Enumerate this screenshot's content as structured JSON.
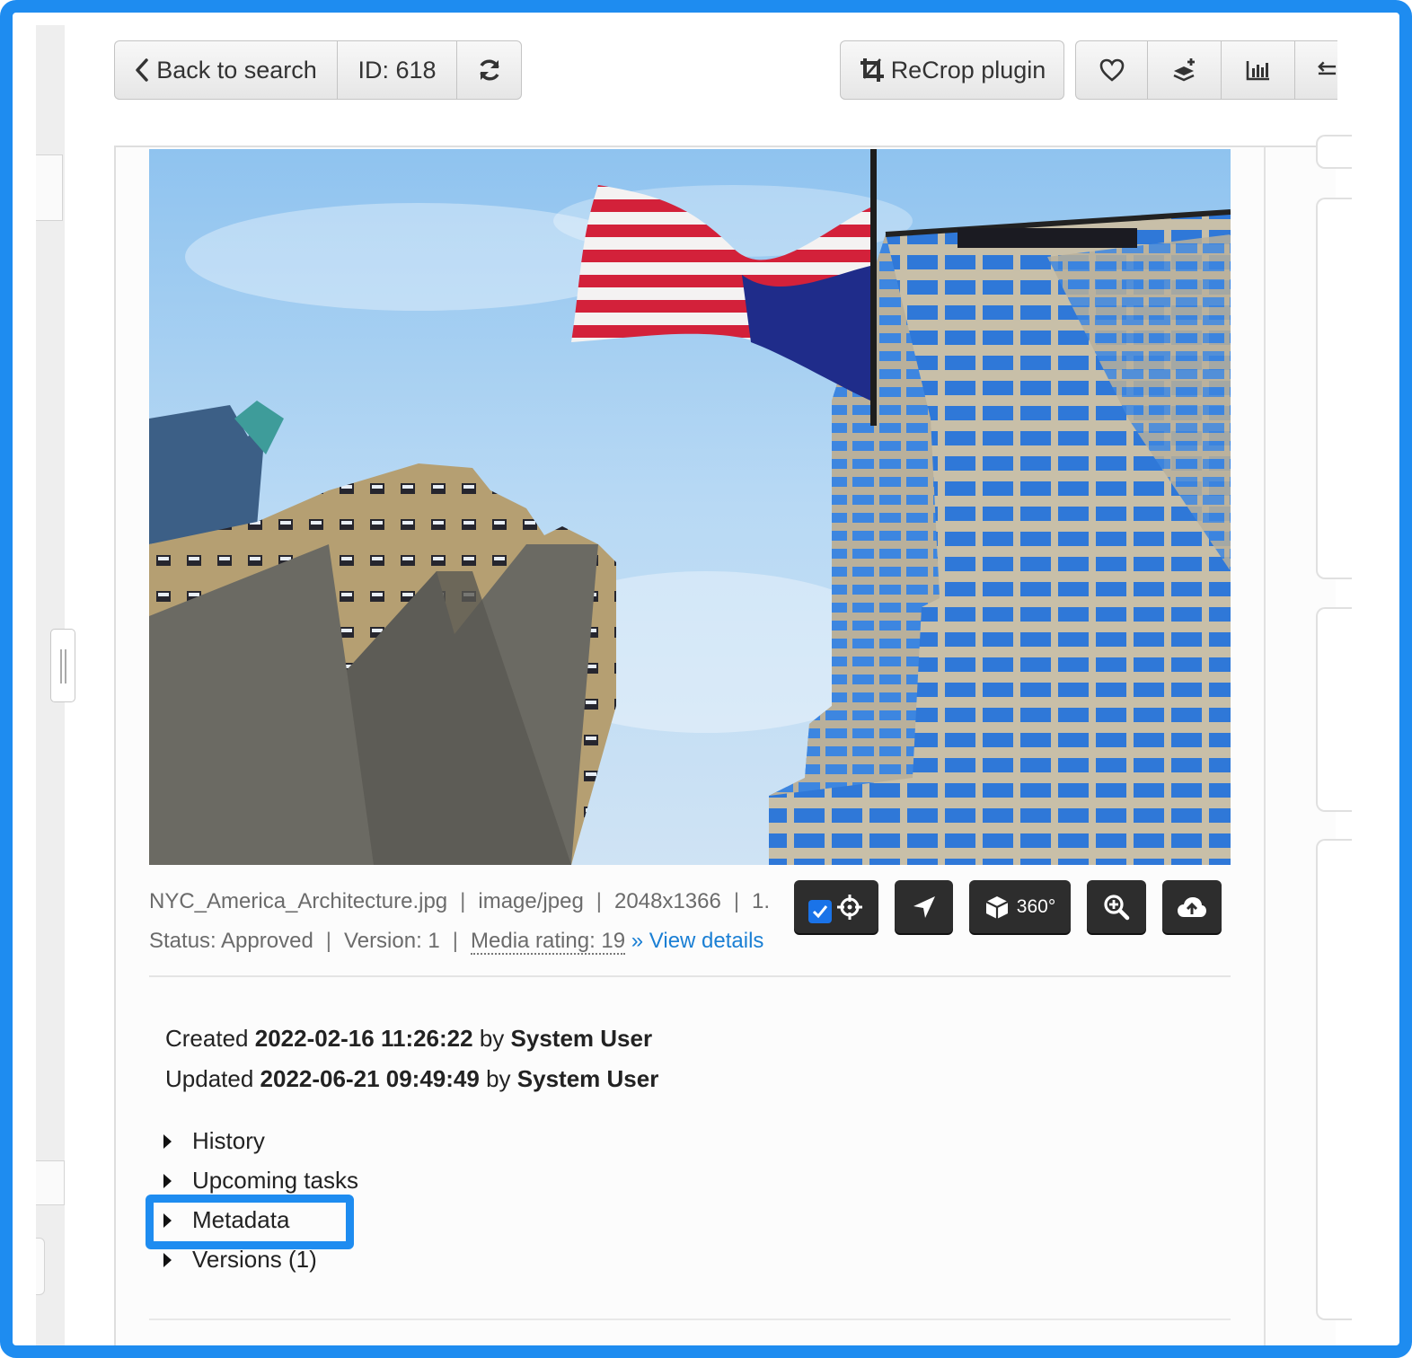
{
  "toolbar": {
    "back_label": "Back to search",
    "id_label": "ID: 618",
    "recrop_label": "ReCrop plugin"
  },
  "file": {
    "name": "NYC_America_Architecture.jpg",
    "mime": "image/jpeg",
    "dimensions": "2048x1366",
    "truncated": "1.",
    "status": "Status: Approved",
    "version": "Version: 1",
    "media_rating": "Media rating: 19",
    "view_details": "» View details"
  },
  "actions": {
    "label_360": "360°",
    "checkbox_checked": true
  },
  "audit": {
    "created_prefix": "Created",
    "created_date": "2022-02-16 11:26:22",
    "created_by_word": "by",
    "created_user": "System User",
    "updated_prefix": "Updated",
    "updated_date": "2022-06-21 09:49:49",
    "updated_by_word": "by",
    "updated_user": "System User"
  },
  "sections": [
    {
      "label": "History"
    },
    {
      "label": "Upcoming tasks"
    },
    {
      "label": "Metadata"
    },
    {
      "label": "Versions (1)"
    }
  ],
  "colors": {
    "frame": "#1e8cf0",
    "link": "#1a7fd4",
    "dark_button": "#2d2d2d"
  }
}
